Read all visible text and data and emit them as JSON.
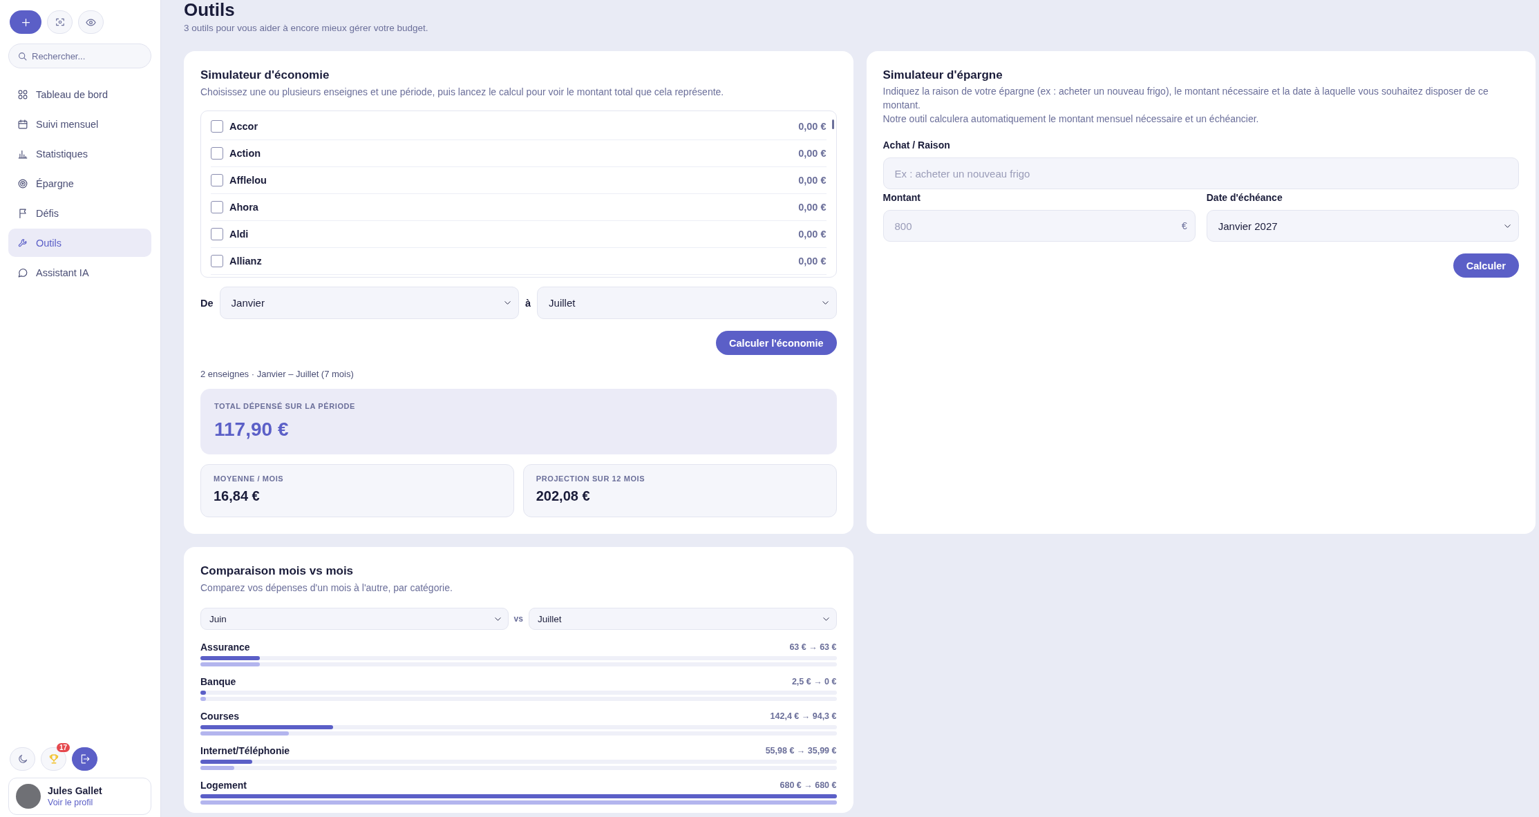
{
  "sidebar": {
    "search": {
      "placeholder": "Rechercher..."
    },
    "nav": [
      {
        "label": "Tableau de bord",
        "selected": false
      },
      {
        "label": "Suivi mensuel",
        "selected": false
      },
      {
        "label": "Statistiques",
        "selected": false
      },
      {
        "label": "Épargne",
        "selected": false
      },
      {
        "label": "Défis",
        "selected": false
      },
      {
        "label": "Outils",
        "selected": true
      },
      {
        "label": "Assistant IA",
        "selected": false
      }
    ],
    "achievements_badge": "17",
    "profile": {
      "name": "Jules Gallet",
      "link": "Voir le profil"
    }
  },
  "header": {
    "title": "Outils",
    "subtitle": "3 outils pour vous aider à encore mieux gérer votre budget."
  },
  "economy_simulator": {
    "title": "Simulateur d'économie",
    "description": "Choisissez une ou plusieurs enseignes et une période, puis lancez le calcul pour voir le montant total que cela représente.",
    "stores": [
      {
        "name": "Accor",
        "amount": "0,00 €",
        "checked": false
      },
      {
        "name": "Action",
        "amount": "0,00 €",
        "checked": false
      },
      {
        "name": "Afflelou",
        "amount": "0,00 €",
        "checked": false
      },
      {
        "name": "Ahora",
        "amount": "0,00 €",
        "checked": false
      },
      {
        "name": "Aldi",
        "amount": "0,00 €",
        "checked": false
      },
      {
        "name": "Allianz",
        "amount": "0,00 €",
        "checked": false
      }
    ],
    "period": {
      "from_label": "De",
      "from": "Janvier",
      "to_label": "à",
      "to": "Juillet"
    },
    "button": "Calculer l'économie",
    "summary": "2 enseignes · Janvier – Juillet (7 mois)",
    "total": {
      "label": "TOTAL DÉPENSÉ SUR LA PÉRIODE",
      "value": "117,90 €"
    },
    "stats": [
      {
        "label": "MOYENNE / MOIS",
        "value": "16,84 €"
      },
      {
        "label": "PROJECTION SUR 12 MOIS",
        "value": "202,08 €"
      }
    ]
  },
  "savings_simulator": {
    "title": "Simulateur d'épargne",
    "description": [
      "Indiquez la raison de votre épargne (ex : acheter un nouveau frigo), le montant nécessaire et la date à laquelle vous souhaitez disposer de ce montant.",
      "Notre outil calculera automatiquement le montant mensuel nécessaire et un échéancier."
    ],
    "reason": {
      "label": "Achat / Raison",
      "placeholder": "Ex : acheter un nouveau frigo"
    },
    "amount": {
      "label": "Montant",
      "placeholder": "800",
      "suffix": "€"
    },
    "due_date": {
      "label": "Date d'échéance",
      "value": "Janvier 2027"
    },
    "button": "Calculer"
  },
  "month_comparison": {
    "title": "Comparaison mois vs mois",
    "description": "Comparez vos dépenses d'un mois à l'autre, par catégorie.",
    "month_a": "Juin",
    "separator": "vs",
    "month_b": "Juillet",
    "categories": [
      {
        "name": "Assurance",
        "amounts": "63 € → 63 €",
        "bars": [
          {
            "level": 0.093
          },
          {
            "level": 0.093
          }
        ]
      },
      {
        "name": "Banque",
        "amounts": "2,5 € → 0 €",
        "bars": [
          {
            "level": 0.004
          },
          {
            "level": 0
          }
        ]
      },
      {
        "name": "Courses",
        "amounts": "142,4 € → 94,3 €",
        "bars": [
          {
            "level": 0.209
          },
          {
            "level": 0.139
          }
        ]
      },
      {
        "name": "Internet/Téléphonie",
        "amounts": "55,98 € → 35,99 €",
        "bars": [
          {
            "level": 0.082
          },
          {
            "level": 0.053
          }
        ]
      },
      {
        "name": "Logement",
        "amounts": "680 € → 680 €",
        "bars": [
          {
            "level": 1
          },
          {
            "level": 1
          }
        ]
      }
    ]
  }
}
